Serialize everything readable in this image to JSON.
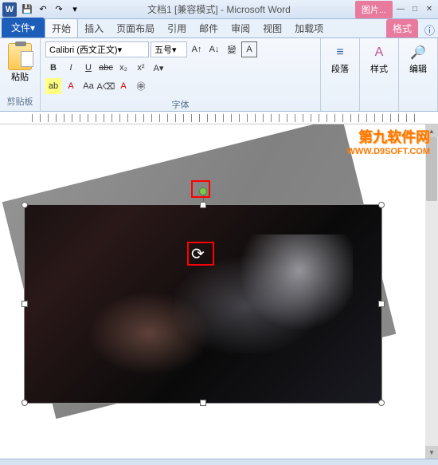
{
  "titlebar": {
    "app_letter": "W",
    "doc_title": "文档1 [兼容模式] - Microsoft Word",
    "context_tool": "图片..."
  },
  "win": {
    "min": "—",
    "max": "□",
    "close": "✕"
  },
  "tabs": {
    "file": "文件",
    "home": "开始",
    "insert": "插入",
    "layout": "页面布局",
    "references": "引用",
    "mail": "邮件",
    "review": "审阅",
    "view": "视图",
    "addins": "加载项",
    "format": "格式"
  },
  "ribbon": {
    "paste": "粘贴",
    "clipboard_label": "剪贴板",
    "font_name": "Calibri (西文正文)",
    "font_size": "五号",
    "font_label": "字体",
    "paragraph": "段落",
    "styles": "样式",
    "editing": "编辑",
    "btns": {
      "B": "B",
      "I": "I",
      "U": "U",
      "abc": "abc",
      "x2": "x₂",
      "x2sup": "x²",
      "Aa": "Aa",
      "A_up": "A",
      "A_dn": "A"
    }
  },
  "groups": {
    "paragraph_icon": "¶",
    "styles_icon": "A",
    "find_icon": "🔍"
  },
  "watermark": {
    "cn": "第九软件网",
    "en": "WWW.D9SOFT.COM"
  },
  "scrollbar": {
    "up": "▲",
    "down": "▼"
  }
}
